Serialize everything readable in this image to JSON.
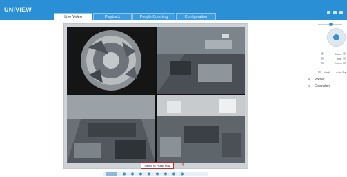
{
  "header": {
    "logo_text": "UNIVIEW",
    "tabs": [
      {
        "label": "Live Video",
        "active": true
      },
      {
        "label": "Playback",
        "active": false
      },
      {
        "label": "People Counting",
        "active": false
      },
      {
        "label": "Configuration",
        "active": false
      }
    ]
  },
  "main": {
    "switch_button_label": "Switch to Plugin Play",
    "annotation_number": "4"
  },
  "ptz": {
    "zoom_label": "Zoom",
    "iris_label": "Iris",
    "focus_label": "Focus",
    "north_label": "North",
    "auto_label": "Auto Pat",
    "menu": [
      {
        "label": "Preset"
      },
      {
        "label": "Extension"
      }
    ]
  },
  "colors": {
    "header_blue": "#2b8fd6",
    "accent_red": "#d8232a",
    "ptz_blue": "#3a8fd4"
  }
}
